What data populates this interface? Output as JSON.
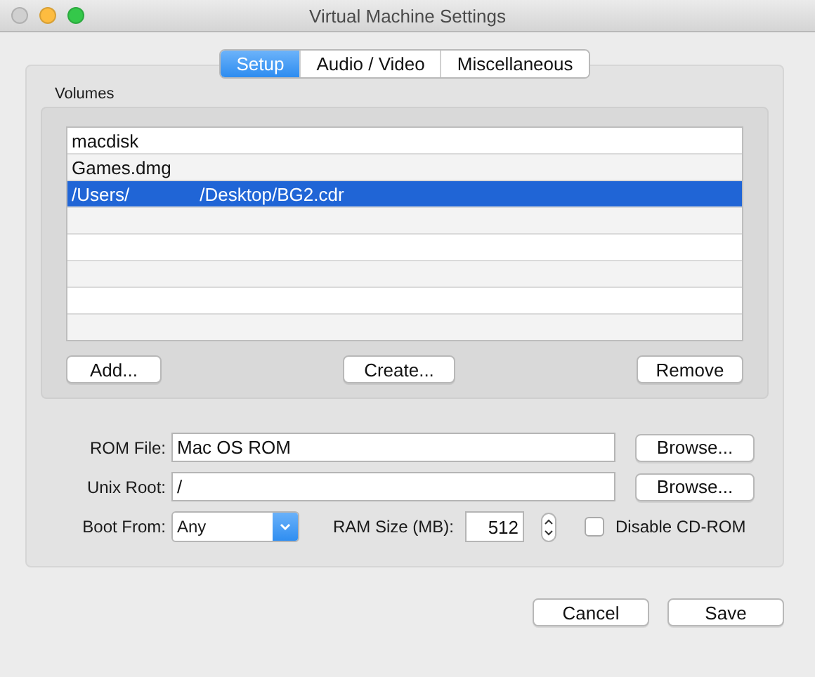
{
  "window": {
    "title": "Virtual Machine Settings"
  },
  "tabs": [
    {
      "label": "Setup",
      "selected": true
    },
    {
      "label": "Audio / Video",
      "selected": false
    },
    {
      "label": "Miscellaneous",
      "selected": false
    }
  ],
  "volumes": {
    "label": "Volumes",
    "rows": [
      {
        "parts": [
          "macdisk"
        ],
        "selected": false
      },
      {
        "parts": [
          "Games.dmg"
        ],
        "selected": false
      },
      {
        "parts": [
          "/Users/",
          "/Desktop/BG2.cdr"
        ],
        "selected": true
      }
    ],
    "buttons": [
      "Add...",
      "Create...",
      "Remove"
    ]
  },
  "rom_file": {
    "label": "ROM File:",
    "value": "Mac OS ROM",
    "button": "Browse..."
  },
  "unix_root": {
    "label": "Unix Root:",
    "value": "/",
    "button": "Browse..."
  },
  "boot_from": {
    "label": "Boot From:",
    "value": "Any"
  },
  "ram_size": {
    "label": "RAM Size (MB):",
    "value": "512"
  },
  "disable_cdrom": {
    "label": "Disable CD-ROM",
    "checked": false
  },
  "buttons": [
    "Cancel",
    "Save"
  ]
}
